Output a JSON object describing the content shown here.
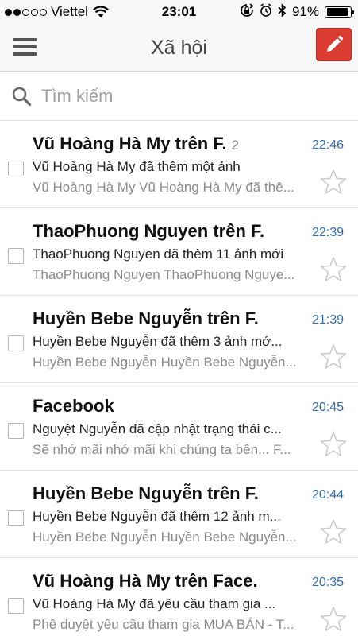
{
  "status_bar": {
    "carrier": "Viettel",
    "time": "23:01",
    "battery": "91%",
    "battery_level": 0.91,
    "signal_bars": 2,
    "icons": [
      "signal-dots-icon",
      "wifi-icon",
      "rotation-lock-icon",
      "alarm-icon",
      "bluetooth-icon",
      "battery-icon"
    ]
  },
  "nav": {
    "title": "Xã hội",
    "menu_icon": "hamburger-menu-icon",
    "compose_icon": "pencil-icon",
    "compose_color": "#dc3b32"
  },
  "search": {
    "placeholder": "Tìm kiếm",
    "value": ""
  },
  "colors": {
    "time": "#2f6db5",
    "snippet": "#8b8b8b"
  },
  "messages": [
    {
      "sender": "Vũ Hoàng Hà My trên F.",
      "count": "2",
      "time": "22:46",
      "subject": "Vũ Hoàng Hà My đã thêm một ảnh",
      "snippet": "Vũ Hoàng Hà My Vũ Hoàng Hà My đã thê..."
    },
    {
      "sender": "ThaoPhuong Nguyen trên F.",
      "count": "",
      "time": "22:39",
      "subject": "ThaoPhuong Nguyen đã thêm 11 ảnh mới",
      "snippet": "ThaoPhuong Nguyen ThaoPhuong Nguye..."
    },
    {
      "sender": "Huyền Bebe Nguyễn trên F.",
      "count": "",
      "time": "21:39",
      "subject": "Huyền Bebe Nguyễn đã thêm 3 ảnh mớ...",
      "snippet": "Huyền Bebe Nguyễn Huyền Bebe Nguyễn..."
    },
    {
      "sender": "Facebook",
      "count": "",
      "time": "20:45",
      "subject": "Nguyệt Nguyễn đã cập nhật trạng thái c...",
      "snippet": "Sẽ nhớ mãi nhớ mãi khi chúng ta bên... F..."
    },
    {
      "sender": "Huyền Bebe Nguyễn trên F.",
      "count": "",
      "time": "20:44",
      "subject": "Huyền Bebe Nguyễn đã thêm 12 ảnh m...",
      "snippet": "Huyền Bebe Nguyễn Huyền Bebe Nguyễn..."
    },
    {
      "sender": "Vũ Hoàng Hà My trên Face.",
      "count": "",
      "time": "20:35",
      "subject": "Vũ Hoàng Hà My đã yêu cầu tham gia ...",
      "snippet": "Phê duyệt yêu cầu tham gia MUA BÁN - T..."
    }
  ]
}
